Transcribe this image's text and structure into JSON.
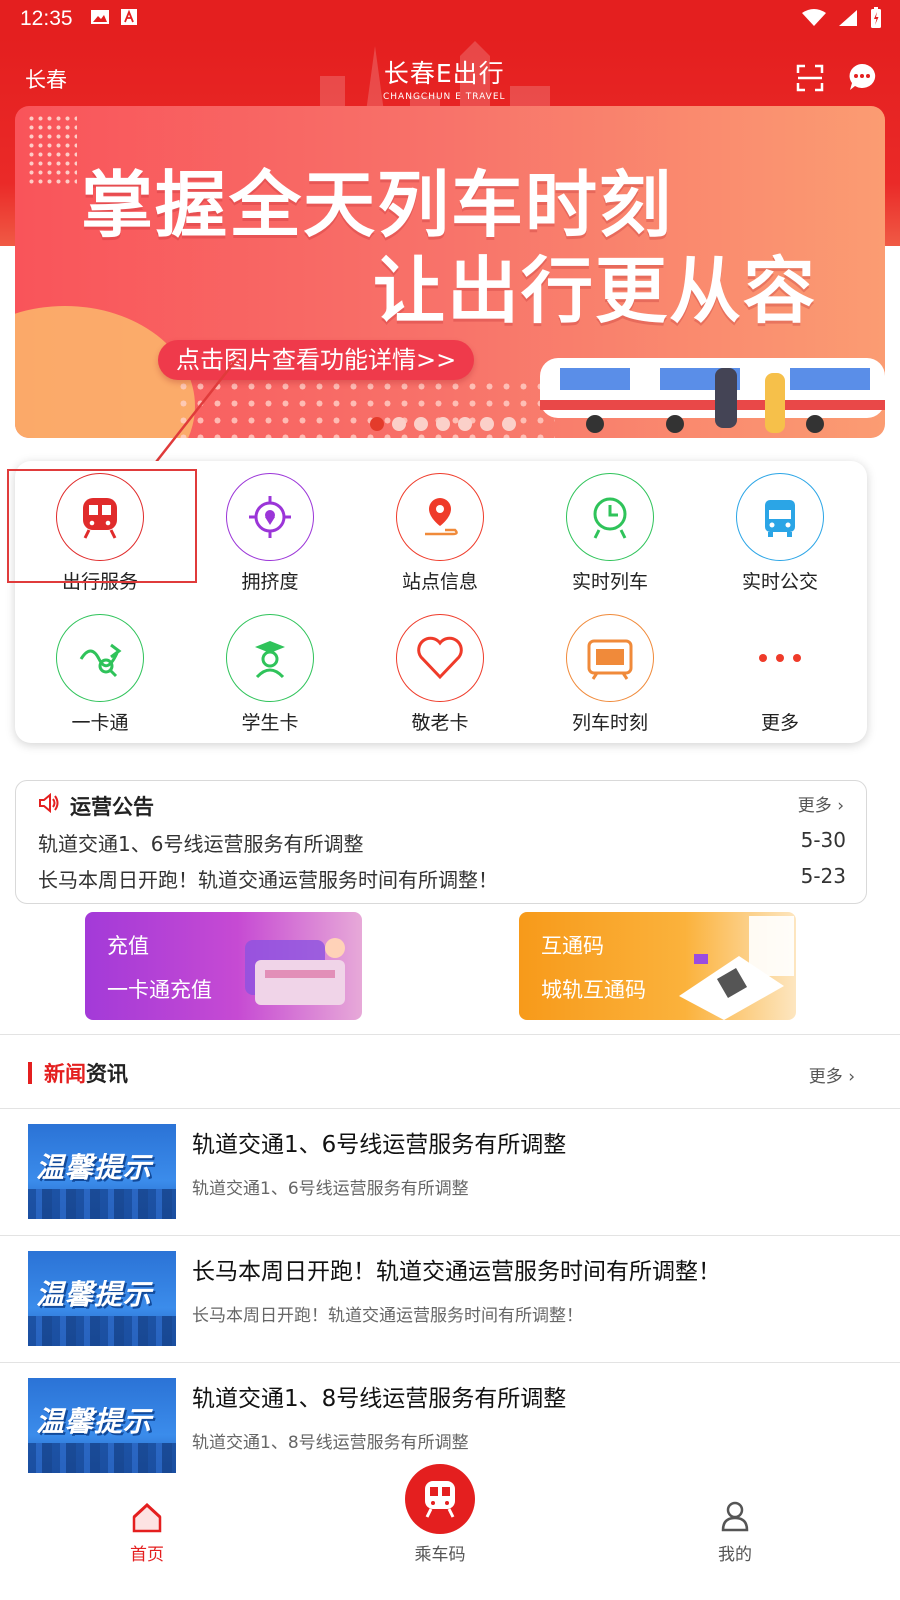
{
  "status_bar": {
    "time": "12:35"
  },
  "header": {
    "city": "长春",
    "logo_main": "长春E出行",
    "logo_sub": "CHANGCHUN E TRAVEL",
    "icons": [
      "scan-icon",
      "message-icon"
    ]
  },
  "banner": {
    "headline": "掌握全天列车时刻",
    "subheadline": "让出行更从容",
    "cta": "点击图片查看功能详情>>",
    "page_count": 7,
    "active_page": 1
  },
  "services": [
    {
      "label": "出行服务",
      "icon": "metro-train-icon",
      "color": "#e02b2b"
    },
    {
      "label": "拥挤度",
      "icon": "target-location-icon",
      "color": "#9b35d8"
    },
    {
      "label": "站点信息",
      "icon": "map-pin-icon",
      "color": "#ef3b2a"
    },
    {
      "label": "实时列车",
      "icon": "clock-train-icon",
      "color": "#2fc35a"
    },
    {
      "label": "实时公交",
      "icon": "bus-icon",
      "color": "#2ba5e6"
    },
    {
      "label": "一卡通",
      "icon": "card-route-icon",
      "color": "#2fc35a"
    },
    {
      "label": "学生卡",
      "icon": "student-icon",
      "color": "#2fc35a"
    },
    {
      "label": "敬老卡",
      "icon": "heart-icon",
      "color": "#ef3b2a"
    },
    {
      "label": "列车时刻",
      "icon": "timetable-icon",
      "color": "#f08a3a"
    },
    {
      "label": "更多",
      "icon": "more-dots-icon",
      "color": "#ef3b2a"
    }
  ],
  "announcements": {
    "title": "运营公告",
    "more": "更多",
    "items": [
      {
        "text": "轨道交通1、6号线运营服务有所调整",
        "date": "5-30"
      },
      {
        "text": "长马本周日开跑！轨道交通运营服务时间有所调整！",
        "date": "5-23"
      }
    ]
  },
  "promos": [
    {
      "title": "充值",
      "subtitle": "一卡通充值"
    },
    {
      "title": "互通码",
      "subtitle": "城轨互通码"
    }
  ],
  "news": {
    "title_red": "新闻",
    "title_black": "资讯",
    "more": "更多",
    "items": [
      {
        "thumb": "温馨提示",
        "title": "轨道交通1、6号线运营服务有所调整",
        "summary": "轨道交通1、6号线运营服务有所调整"
      },
      {
        "thumb": "温馨提示",
        "title": "长马本周日开跑！轨道交通运营服务时间有所调整！",
        "summary": "长马本周日开跑！轨道交通运营服务时间有所调整！"
      },
      {
        "thumb": "温馨提示",
        "title": "轨道交通1、8号线运营服务有所调整",
        "summary": "轨道交通1、8号线运营服务有所调整"
      }
    ]
  },
  "bottom_nav": [
    {
      "label": "首页",
      "icon": "home-icon",
      "active": true
    },
    {
      "label": "乘车码",
      "icon": "train-icon",
      "active": false
    },
    {
      "label": "我的",
      "icon": "user-icon",
      "active": false
    }
  ],
  "colors": {
    "brand_red": "#e41f1f"
  }
}
